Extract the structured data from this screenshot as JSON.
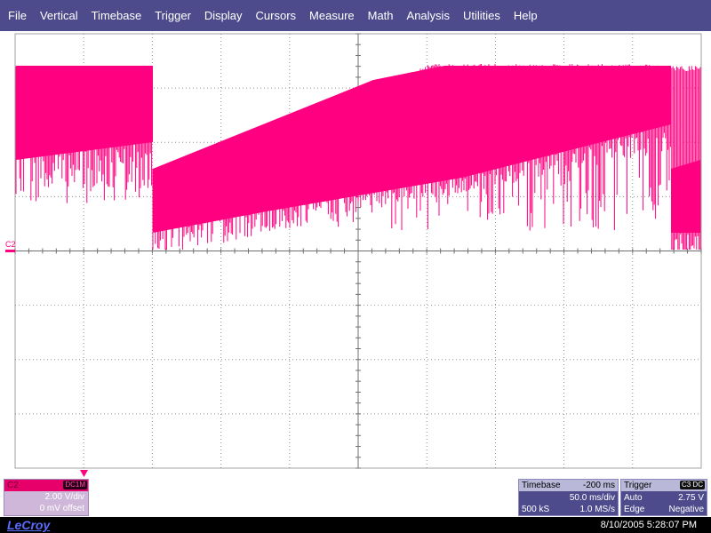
{
  "menu": [
    "File",
    "Vertical",
    "Timebase",
    "Trigger",
    "Display",
    "Cursors",
    "Measure",
    "Math",
    "Analysis",
    "Utilities",
    "Help"
  ],
  "channel": {
    "name": "C2",
    "marker_label": "C2",
    "coupling": "DC1M",
    "volts_per_div": "2.00 V/div",
    "offset": "0 mV offset",
    "color": "#ff0080"
  },
  "timebase": {
    "label": "Timebase",
    "delay": "-200 ms",
    "time_per_div": "50.0 ms/div",
    "samples": "500 kS",
    "sample_rate": "1.0 MS/s"
  },
  "trigger": {
    "label": "Trigger",
    "source": "C3 DC",
    "mode": "Auto",
    "level": "2.75 V",
    "type": "Edge",
    "slope": "Negative"
  },
  "status": {
    "brand": "LeCroy",
    "datetime": "8/10/2005 5:28:07 PM"
  },
  "colors": {
    "menu_bg": "#4e4b8d",
    "trace": "#ff0080",
    "grid": "#909090"
  },
  "icons": {
    "trigger_position": "triangle-down-icon",
    "channel_marker": "channel-level-marker-icon"
  }
}
